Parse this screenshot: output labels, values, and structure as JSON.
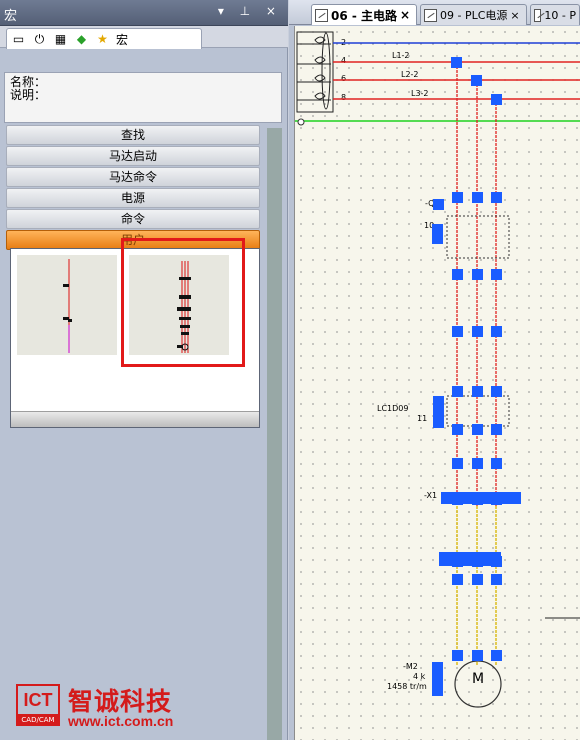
{
  "panel": {
    "title": "宏",
    "controls": "▾ ⊥ ×",
    "tab_label": "宏",
    "info": {
      "name_label": "名称：",
      "desc_label": "说明："
    },
    "buttons": [
      {
        "label": "查找"
      },
      {
        "label": "马达启动"
      },
      {
        "label": "马达命令"
      },
      {
        "label": "电源"
      },
      {
        "label": "命令"
      },
      {
        "label": "用户"
      }
    ]
  },
  "logo": {
    "mark": "ICT",
    "sub": "CAD/CAM",
    "brand": "智诚科技",
    "url": "www.ict.com.cn"
  },
  "document": {
    "tabs": [
      {
        "label": "06 - 主电路",
        "close": "×",
        "active": true
      },
      {
        "label": "09 - PLC电源",
        "close": "×",
        "active": false
      },
      {
        "label": "10 - P",
        "close": "",
        "active": false
      }
    ],
    "schematic": {
      "bus_labels": [
        "L1-2",
        "L2-2",
        "L3-2"
      ],
      "terminal_numbers": [
        "2",
        "4",
        "6",
        "8"
      ],
      "component_labels": [
        "-Q",
        "10",
        "LC1D09",
        "11",
        "-X1",
        "-M2",
        "4 k",
        "1458 tr/m"
      ],
      "motor_label": "M",
      "colors": {
        "bus_blue": "#1f3fd6",
        "bus_red": "#e02222",
        "bus_green": "#1fd21f",
        "wire_red": "#e02222",
        "wire_yellow": "#d8b400",
        "connector": "#1a5cff"
      }
    }
  }
}
